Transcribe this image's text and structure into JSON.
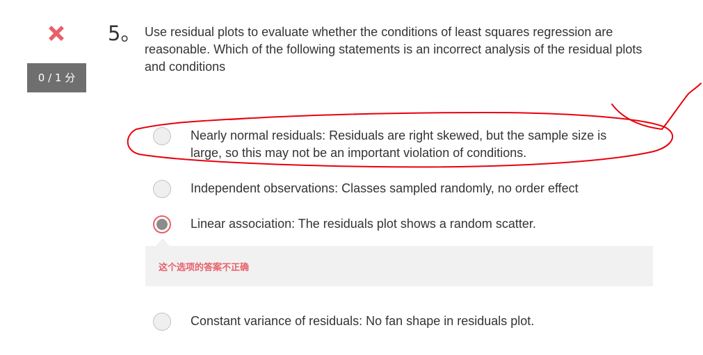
{
  "question": {
    "number": "5。",
    "text": "Use residual plots to evaluate whether the conditions of least squares regression are reasonable. Which of the following statements is an incorrect analysis of the residual plots and conditions",
    "score": "0 / 1 分",
    "status_icon": "cross-icon",
    "status_color": "#e8606b"
  },
  "options": [
    {
      "text": "Nearly normal residuals: Residuals are right skewed, but the sample size is large, so this may not be an important violation of conditions.",
      "selected": false
    },
    {
      "text": "Independent observations: Classes sampled randomly, no order effect",
      "selected": false
    },
    {
      "text": "Linear association: The residuals plot shows a random scatter.",
      "selected": true
    },
    {
      "text": "Constant variance of residuals: No fan shape in residuals plot.",
      "selected": false
    }
  ],
  "feedback": {
    "text": "这个选项的答案不正确",
    "color": "#e8606b"
  },
  "annotation": {
    "color": "#e8000b"
  }
}
